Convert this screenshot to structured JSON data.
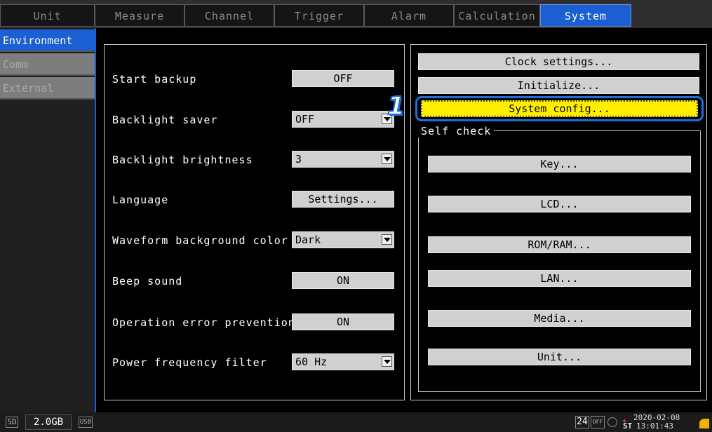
{
  "tabs": [
    "Unit",
    "Measure",
    "Channel",
    "Trigger",
    "Alarm",
    "Calculation",
    "System"
  ],
  "side_tabs": [
    "Environment",
    "Comm",
    "External"
  ],
  "settings": {
    "start_backup": {
      "label": "Start backup",
      "value": "OFF"
    },
    "backlight_saver": {
      "label": "Backlight saver",
      "value": "OFF"
    },
    "backlight_brightness": {
      "label": "Backlight brightness",
      "value": "3"
    },
    "language": {
      "label": "Language",
      "value": "Settings..."
    },
    "waveform_bg": {
      "label": "Waveform background color",
      "value": "Dark"
    },
    "beep": {
      "label": "Beep sound",
      "value": "ON"
    },
    "op_error": {
      "label": "Operation error prevention",
      "value": "ON"
    },
    "power_filter": {
      "label": "Power frequency filter",
      "value": "60 Hz"
    }
  },
  "system_buttons": {
    "clock": "Clock settings...",
    "initialize": "Initialize...",
    "system_config": "System config..."
  },
  "self_check": {
    "title": "Self check",
    "buttons": [
      "Key...",
      "LCD...",
      "ROM/RAM...",
      "LAN...",
      "Media...",
      "Unit..."
    ]
  },
  "callout_number": "1",
  "status": {
    "sd_label": "SD",
    "capacity": "2.0GB",
    "usb_label": "USB",
    "hours": "24",
    "off_label": "OFF",
    "date": "2020-02-08",
    "time": "13:01:43",
    "st_label": "ST"
  }
}
